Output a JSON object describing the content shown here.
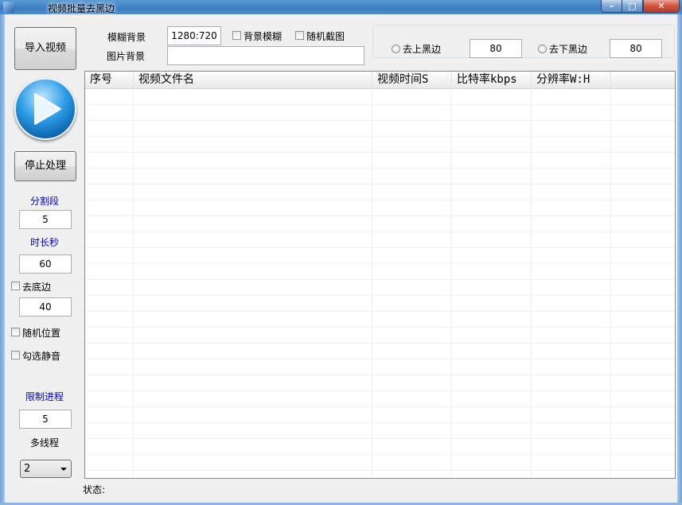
{
  "window": {
    "title": "视频批量去黑边"
  },
  "left": {
    "import_label": "导入视频",
    "stop_label": "停止处理",
    "segments_label": "分割段",
    "segments_value": "5",
    "duration_label": "时长秒",
    "duration_value": "60",
    "remove_bottom_label": "去底边",
    "remove_bottom_value": "40",
    "random_pos_label": "随机位置",
    "mute_label": "勾选静音",
    "limit_label": "限制进程",
    "limit_value": "5",
    "threads_label": "多线程",
    "threads_value": "2"
  },
  "top": {
    "blur_bg_label": "模糊背景",
    "blur_bg_value": "1280:720",
    "bg_blur_check_label": "背景模糊",
    "random_snap_label": "随机截图",
    "image_bg_label": "图片背景",
    "image_bg_value": ""
  },
  "options": {
    "remove_top_label": "去上黑边",
    "remove_top_value": "80",
    "remove_bottom_label": "去下黑边",
    "remove_bottom_value": "80"
  },
  "table": {
    "columns": [
      "序号",
      "视频文件名",
      "视频时间S",
      "比特率kbps",
      "分辨率W:H",
      ""
    ]
  },
  "status": {
    "label": "状态:"
  }
}
